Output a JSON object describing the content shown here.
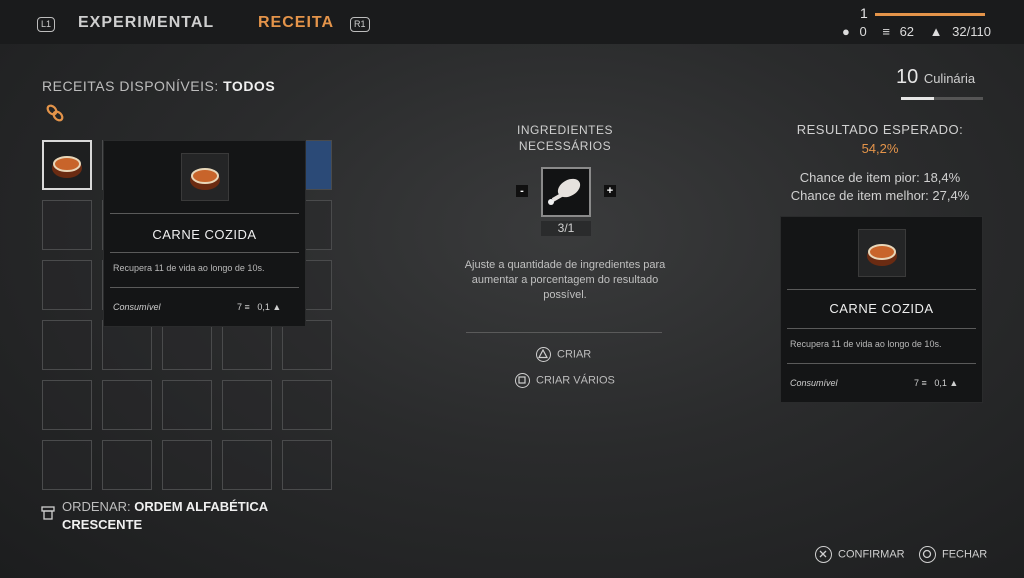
{
  "header": {
    "left_shoulder": "L1",
    "right_shoulder": "R1",
    "tabs": [
      {
        "label": "EXPERIMENTAL",
        "active": false
      },
      {
        "label": "RECEITA",
        "active": true
      }
    ],
    "level": "1",
    "stats": {
      "currency": "0",
      "credits": "62",
      "weight": "32/110"
    },
    "accent_color": "#e4944a"
  },
  "recipes": {
    "label": "RECEITAS DISPONÍVEIS:",
    "filter": "TODOS",
    "tooltip": {
      "name": "CARNE COZIDA",
      "description": "Recupera 11 de vida ao longo de 10s.",
      "type": "Consumível",
      "value": "7",
      "weight": "0,1"
    }
  },
  "ingredients": {
    "title_line1": "INGREDIENTES",
    "title_line2": "NECESSÁRIOS",
    "minus": "-",
    "plus": "+",
    "count": "3/1",
    "hint": "Ajuste a quantidade de ingredientes para aumentar a porcentagem do resultado possível.",
    "create": "CRIAR",
    "create_many": "CRIAR VÁRIOS"
  },
  "skill": {
    "level": "10",
    "name": "Culinária",
    "progress": 0.4
  },
  "result": {
    "title": "RESULTADO ESPERADO:",
    "percent": "54,2%",
    "worse": "Chance de item pior: 18,4%",
    "better": "Chance de item melhor: 27,4%",
    "item": {
      "name": "CARNE COZIDA",
      "description": "Recupera 11 de vida ao longo de 10s.",
      "type": "Consumível",
      "value": "7",
      "weight": "0,1"
    }
  },
  "sort": {
    "label": "ORDENAR:",
    "line1": "ORDEM ALFABÉTICA",
    "line2": "CRESCENTE"
  },
  "footer": {
    "confirm": "CONFIRMAR",
    "close": "FECHAR"
  }
}
